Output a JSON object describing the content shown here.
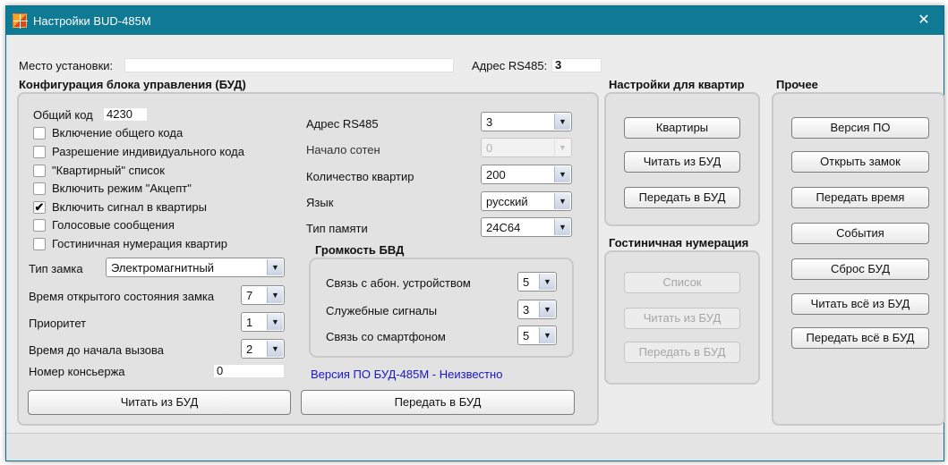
{
  "window": {
    "title": "Настройки BUD-485M",
    "close_glyph": "✕"
  },
  "top": {
    "install_place_label": "Место установки:",
    "install_place_value": "",
    "rs485_label": "Адрес RS485:",
    "rs485_value": "3"
  },
  "config": {
    "title": "Конфигурация блока управления (БУД)",
    "common_code_label": "Общий код",
    "common_code_value": "4230",
    "checkboxes": [
      {
        "label": "Включение общего кода",
        "checked": false
      },
      {
        "label": "Разрешение индивидуального кода",
        "checked": false
      },
      {
        "label": "\"Квартирный\" список",
        "checked": false
      },
      {
        "label": "Включить режим \"Акцепт\"",
        "checked": false
      },
      {
        "label": "Включить сигнал в квартиры",
        "checked": true
      },
      {
        "label": "Голосовые сообщения",
        "checked": false
      },
      {
        "label": "Гостиничная нумерация квартир",
        "checked": false
      }
    ],
    "lock_type_label": "Тип замка",
    "lock_type_value": "Электромагнитный",
    "open_time_label": "Время открытого состояния замка",
    "open_time_value": "7",
    "priority_label": "Приоритет",
    "priority_value": "1",
    "call_delay_label": "Время до начала вызова",
    "call_delay_value": "2",
    "concierge_label": "Номер консьержа",
    "concierge_value": "0",
    "rs485_label": "Адрес RS485",
    "rs485_value": "3",
    "hundreds_label": "Начало сотен",
    "hundreds_value": "0",
    "apartments_label": "Количество квартир",
    "apartments_value": "200",
    "language_label": "Язык",
    "language_value": "русский",
    "memory_label": "Тип памяти",
    "memory_value": "24C64",
    "volume_title": "Громкость БВД",
    "volume_items": [
      {
        "label": "Связь с абон. устройством",
        "value": "5"
      },
      {
        "label": "Служебные сигналы",
        "value": "3"
      },
      {
        "label": "Связь со смартфоном",
        "value": "5"
      }
    ],
    "firmware_status": "Версия ПО БУД-485M - Неизвестно",
    "read_button": "Читать из БУД",
    "write_button": "Передать в БУД"
  },
  "apartments": {
    "title": "Настройки для квартир",
    "buttons": [
      "Квартиры",
      "Читать из БУД",
      "Передать в БУД"
    ]
  },
  "hotel": {
    "title": "Гостиничная нумерация",
    "buttons": [
      "Список",
      "Читать из БУД",
      "Передать в БУД"
    ]
  },
  "other": {
    "title": "Прочее",
    "buttons": [
      "Версия ПО",
      "Открыть замок",
      "Передать время",
      "События",
      "Сброс БУД",
      "Читать всё из БУД",
      "Передать всё в БУД"
    ]
  },
  "icons": {
    "dropdown_arrow": "▼",
    "check": "✔"
  },
  "colors": {
    "titlebar": "#0f7a94",
    "status_text": "#1717c8"
  }
}
